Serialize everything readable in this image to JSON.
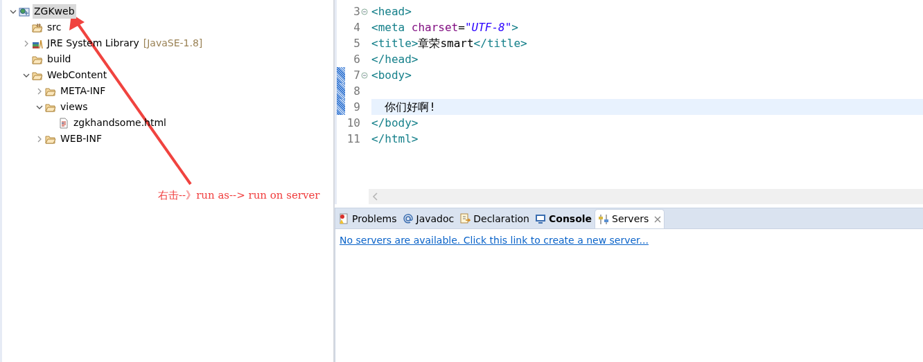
{
  "project_tree": [
    {
      "label": "ZGKweb",
      "kind": "project",
      "expanded": true,
      "selected": true,
      "children": [
        {
          "label": "src",
          "kind": "sourcefolder"
        },
        {
          "label": "JRE System Library",
          "suffix": "[JavaSE-1.8]",
          "kind": "library",
          "expanded": false
        },
        {
          "label": "build",
          "kind": "folder"
        },
        {
          "label": "WebContent",
          "kind": "folder",
          "expanded": true,
          "children": [
            {
              "label": "META-INF",
              "kind": "folder",
              "expanded": false
            },
            {
              "label": "views",
              "kind": "folder",
              "expanded": true,
              "children": [
                {
                  "label": "zgkhandsome.html",
                  "kind": "file"
                }
              ]
            },
            {
              "label": "WEB-INF",
              "kind": "folder",
              "expanded": false
            }
          ]
        }
      ]
    }
  ],
  "editor": {
    "lines": [
      {
        "number": "3",
        "fold": true,
        "changed": false,
        "current": false,
        "tokens": [
          {
            "kind": "tag",
            "text": "<head>"
          }
        ]
      },
      {
        "number": "4",
        "fold": false,
        "changed": false,
        "current": false,
        "tokens": [
          {
            "kind": "tag",
            "text": "<meta "
          },
          {
            "kind": "attr",
            "text": "charset"
          },
          {
            "kind": "text",
            "text": "="
          },
          {
            "kind": "string",
            "text": "\"UTF-8\""
          },
          {
            "kind": "tag",
            "text": ">"
          }
        ]
      },
      {
        "number": "5",
        "fold": false,
        "changed": false,
        "current": false,
        "tokens": [
          {
            "kind": "tag",
            "text": "<title>"
          },
          {
            "kind": "text",
            "text": "章荣smart"
          },
          {
            "kind": "tag",
            "text": "</title>"
          }
        ]
      },
      {
        "number": "6",
        "fold": false,
        "changed": false,
        "current": false,
        "tokens": [
          {
            "kind": "tag",
            "text": "</head>"
          }
        ]
      },
      {
        "number": "7",
        "fold": true,
        "changed": true,
        "current": false,
        "tokens": [
          {
            "kind": "tag",
            "text": "<body>"
          }
        ]
      },
      {
        "number": "8",
        "fold": false,
        "changed": true,
        "current": false
      },
      {
        "number": "9",
        "fold": false,
        "changed": true,
        "current": true,
        "tokens": [
          {
            "kind": "text",
            "text": "  你们好啊!"
          }
        ]
      },
      {
        "number": "10",
        "fold": false,
        "changed": false,
        "current": false,
        "tokens": [
          {
            "kind": "tag",
            "text": "</body>"
          }
        ]
      },
      {
        "number": "11",
        "fold": false,
        "changed": false,
        "current": false,
        "tokens": [
          {
            "kind": "tag",
            "text": "</html>"
          }
        ]
      }
    ]
  },
  "bottom_tabs": [
    {
      "label": "Problems",
      "kind": "problems",
      "selected": false,
      "bold": false,
      "closable": false
    },
    {
      "label": "Javadoc",
      "kind": "javadoc",
      "selected": false,
      "bold": false,
      "closable": false
    },
    {
      "label": "Declaration",
      "kind": "declaration",
      "selected": false,
      "bold": false,
      "closable": false
    },
    {
      "label": "Console",
      "kind": "console",
      "selected": false,
      "bold": true,
      "closable": false
    },
    {
      "label": "Servers",
      "kind": "servers",
      "selected": true,
      "bold": false,
      "closable": true
    }
  ],
  "servers_link": "No servers are available. Click this link to create a new server...",
  "annotation": {
    "text": "右击--》run as--> run on server"
  }
}
